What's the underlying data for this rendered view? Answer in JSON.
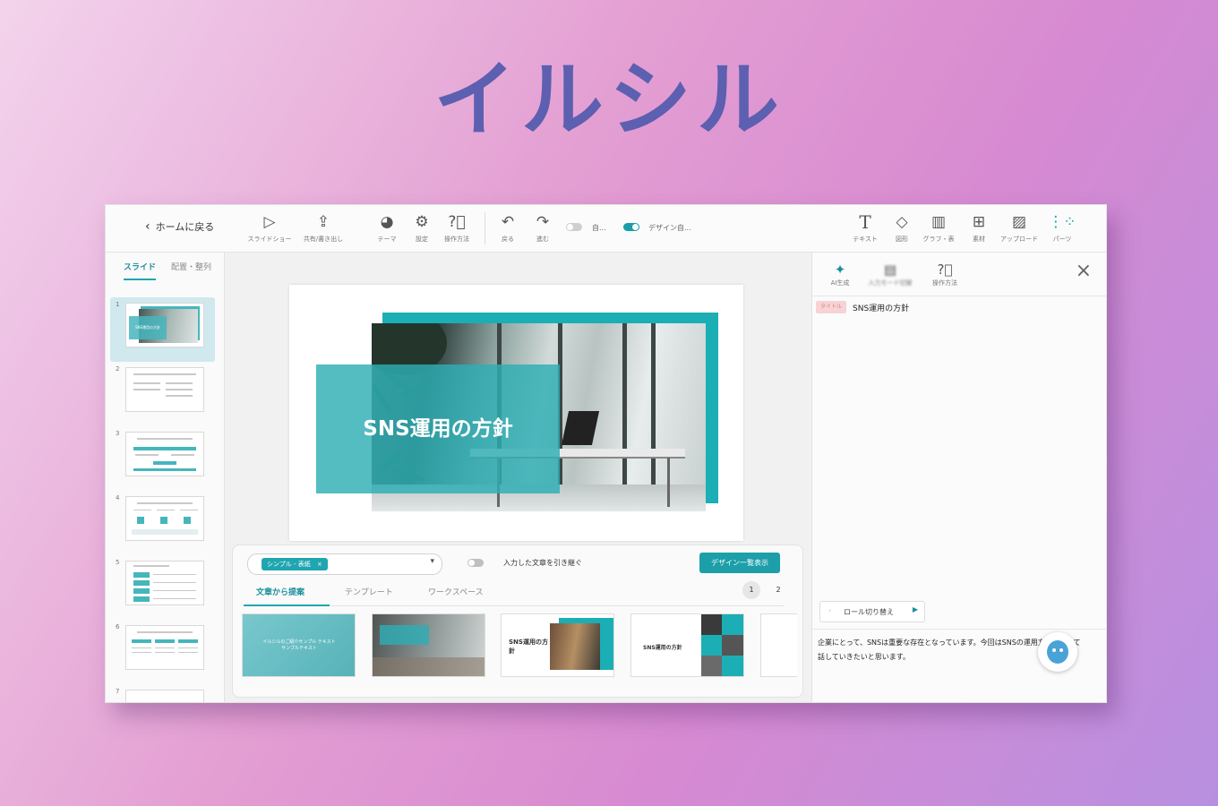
{
  "hero": {
    "title": "イルシル"
  },
  "toolbar": {
    "back_label": "ホームに戻る",
    "tools": [
      {
        "icon": "play-screen-icon",
        "label": "スライドショー"
      },
      {
        "icon": "share-icon",
        "label": "共有/書き出し"
      },
      {
        "icon": "palette-icon",
        "label": "テーマ"
      },
      {
        "icon": "gear-icon",
        "label": "設定"
      },
      {
        "icon": "help-circle-icon",
        "label": "操作方法"
      },
      {
        "icon": "undo-icon",
        "label": "戻る"
      },
      {
        "icon": "redo-icon",
        "label": "進む"
      }
    ],
    "toggle1_label": "自...",
    "toggle2_label": "デザイン自...",
    "right_tools": [
      {
        "icon": "text-icon",
        "label": "テキスト"
      },
      {
        "icon": "shape-icon",
        "label": "図形"
      },
      {
        "icon": "chart-icon",
        "label": "グラフ・表"
      },
      {
        "icon": "assets-icon",
        "label": "素材"
      },
      {
        "icon": "image-upload-icon",
        "label": "アップロード"
      },
      {
        "icon": "parts-icon",
        "label": "パーツ"
      }
    ]
  },
  "left_panel": {
    "tabs": [
      "スライド",
      "配置・整列"
    ],
    "slide_numbers": [
      "1",
      "2",
      "3",
      "4",
      "5",
      "6",
      "7"
    ],
    "thumb1_title": "SNS運用の方針"
  },
  "slide": {
    "title": "SNS運用の方針"
  },
  "design_panel": {
    "selected_chip": "シンプル - 表紙",
    "chip_close": "×",
    "toggle_label": "入力した文章を引き継ぐ",
    "list_button": "デザイン一覧表示",
    "tabs": [
      "文章から提案",
      "テンプレート",
      "ワークスペース"
    ],
    "pages": [
      "1",
      "2"
    ],
    "card1_text": "イルシルのご紹介サンプル テキストサンプルテキスト",
    "card3_title": "SNS運用の方針",
    "card4_title": "SNS運用の方針"
  },
  "right_panel": {
    "tools": [
      {
        "icon": "sparkle-icon",
        "label": "AI生成"
      },
      {
        "icon": "input-mode-icon",
        "label": "入力モード切替"
      },
      {
        "icon": "help-circle-icon",
        "label": "操作方法"
      }
    ],
    "close": "×",
    "tag": "タイトル",
    "title": "SNS運用の方針",
    "role_switch": "ロール切り替え",
    "body_text": "企業にとって、SNSは重要な存在となっています。今回はSNSの運用方針について話していきたいと思います。"
  },
  "colors": {
    "accent": "#1fa6b0",
    "hero_text": "#5d5fb0",
    "background_pink": "#e39ed2",
    "background_purple": "#b88fe0"
  }
}
